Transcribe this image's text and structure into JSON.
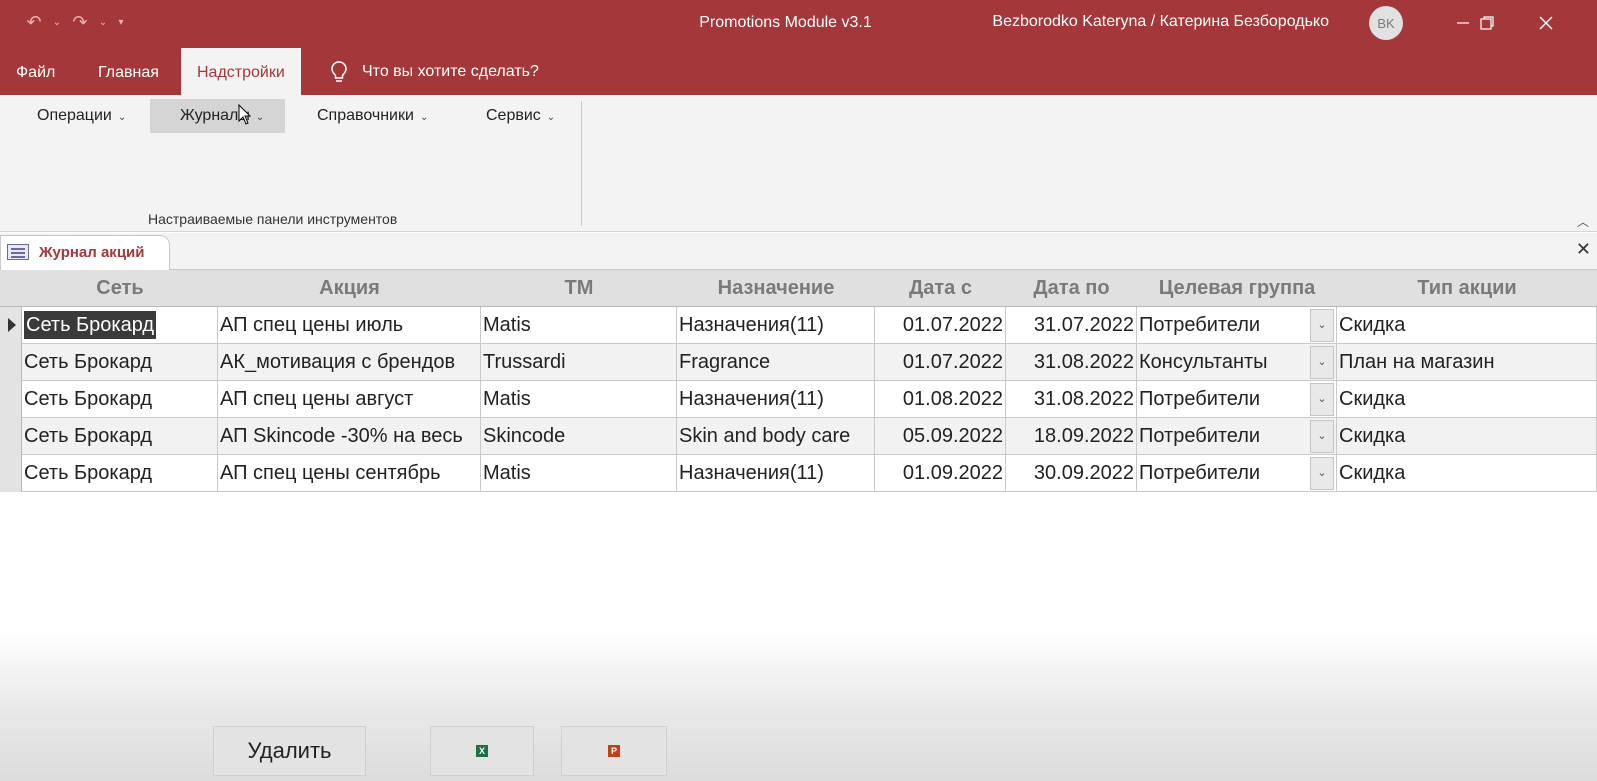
{
  "window": {
    "title": "Promotions Module v3.1",
    "user": "Bezborodko Kateryna / Катерина Безбородько",
    "avatar_initials": "BK"
  },
  "tabs": [
    {
      "label": "Файл"
    },
    {
      "label": "Главная"
    },
    {
      "label": "Надстройки",
      "active": true
    }
  ],
  "tell_me": "Что вы хотите сделать?",
  "ribbon": {
    "buttons": [
      {
        "label": "Операции"
      },
      {
        "label": "Журналы"
      },
      {
        "label": "Справочники"
      },
      {
        "label": "Сервис"
      }
    ],
    "group_label": "Настраиваемые панели инструментов"
  },
  "document_tab": "Журнал акций",
  "table": {
    "columns": [
      "Сеть",
      "Акция",
      "ТМ",
      "Назначение",
      "Дата с",
      "Дата по",
      "Целевая группа",
      "Тип акции"
    ],
    "rows": [
      [
        "Сеть Брокард",
        "АП спец цены июль",
        "Matis",
        "Назначения(11)",
        "01.07.2022",
        "31.07.2022",
        "Потребители",
        "Скидка"
      ],
      [
        "Сеть Брокард",
        "АК_мотивация с брендов",
        "Trussardi",
        "Fragrance",
        "01.07.2022",
        "31.08.2022",
        "Консультанты",
        "План на магазин"
      ],
      [
        "Сеть Брокард",
        "АП спец цены август",
        "Matis",
        "Назначения(11)",
        "01.08.2022",
        "31.08.2022",
        "Потребители",
        "Скидка"
      ],
      [
        "Сеть Брокард",
        "АП Skincode -30% на весь",
        "Skincode",
        "Skin and body care",
        "05.09.2022",
        "18.09.2022",
        "Потребители",
        "Скидка"
      ],
      [
        "Сеть Брокард",
        "АП спец цены сентябрь",
        "Matis",
        "Назначения(11)",
        "01.09.2022",
        "30.09.2022",
        "Потребители",
        "Скидка"
      ]
    ]
  },
  "bottom": {
    "delete_label": "Удалить",
    "excel_icon": "X",
    "ppt_icon": "P"
  },
  "colors": {
    "brand": "#a4373a",
    "ribbon_bg": "#f3f3f3"
  }
}
